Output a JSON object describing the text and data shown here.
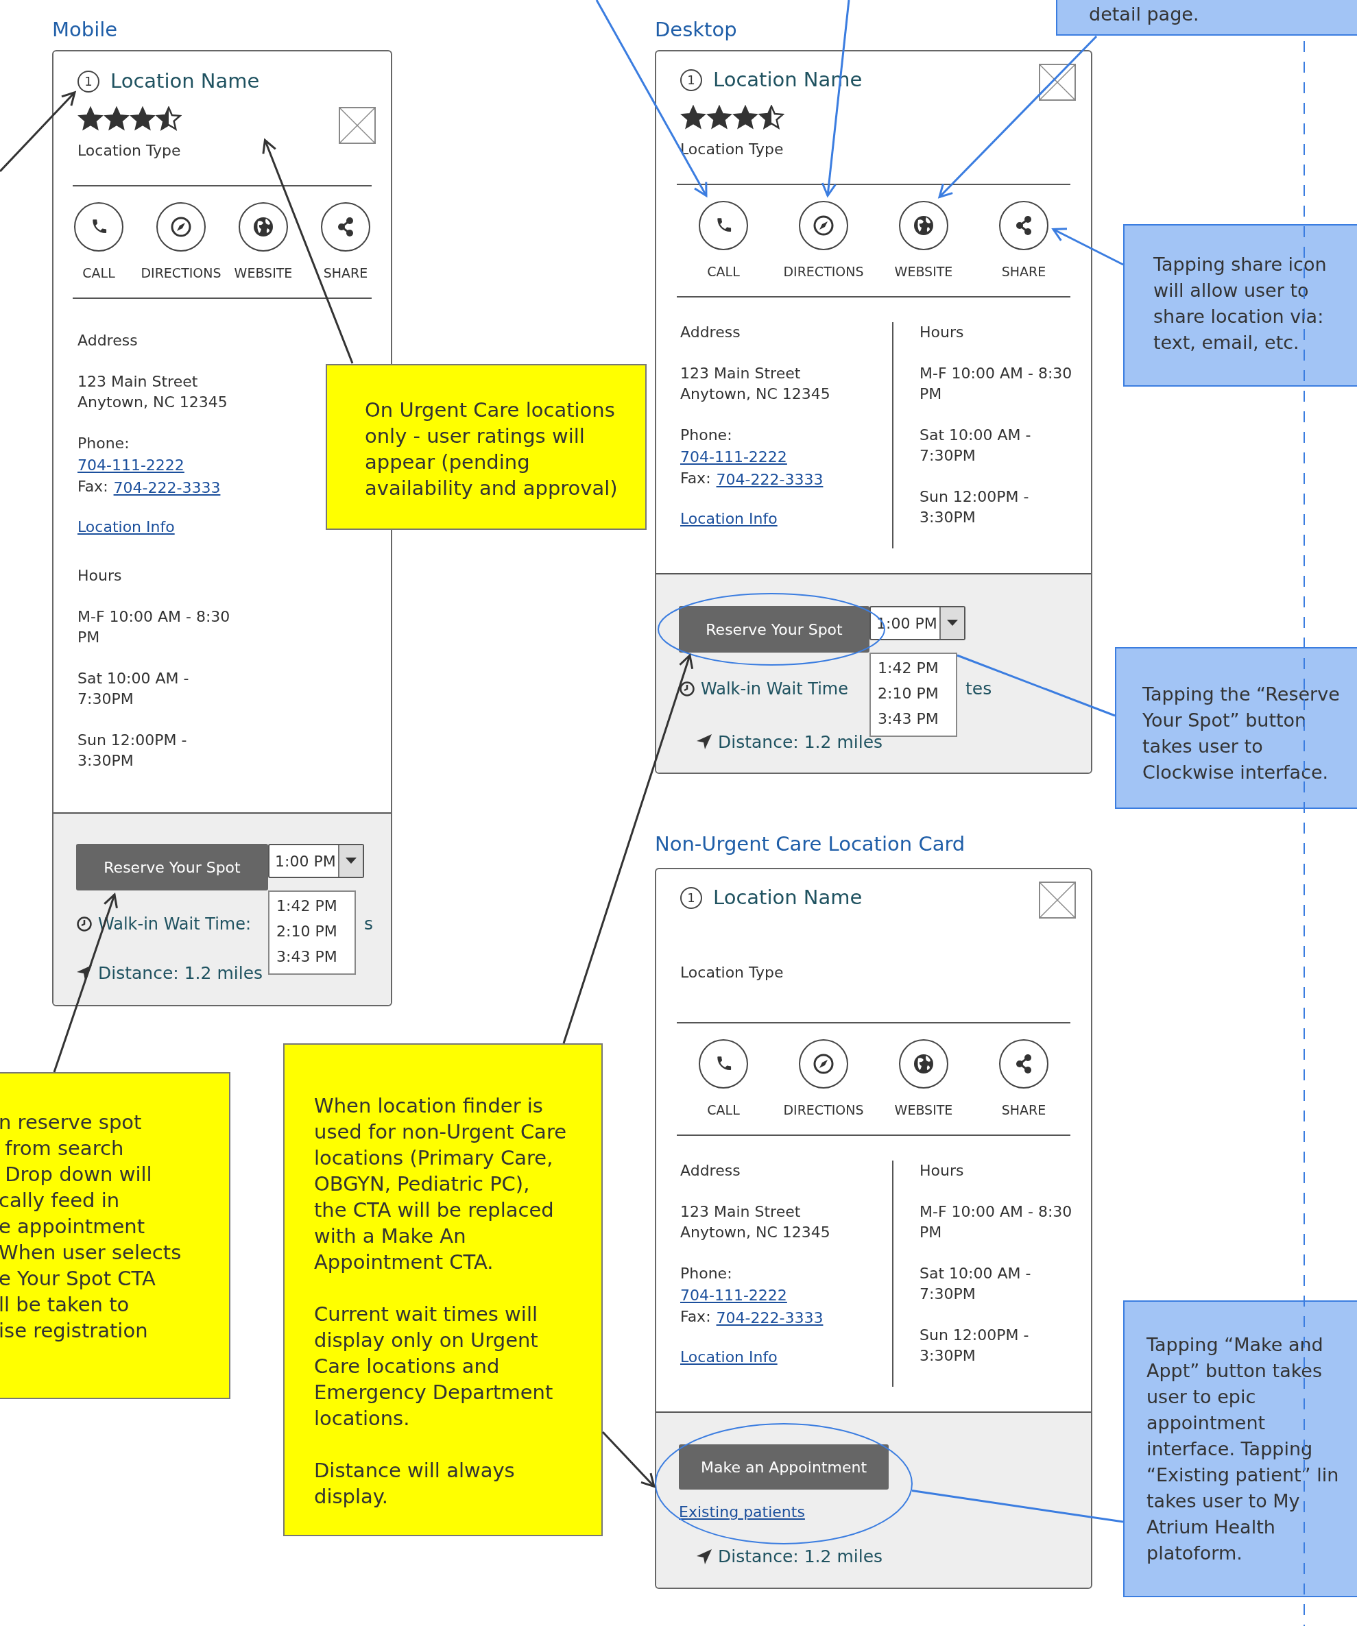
{
  "panels": [
    {
      "heading": "Mobile",
      "card": {
        "kind": "mobile",
        "number": "1",
        "name": "Location Name",
        "stars": 3.5,
        "type": "Location Type",
        "actions": [
          {
            "kind": "call",
            "label": "CALL"
          },
          {
            "kind": "directions",
            "label": "DIRECTIONS"
          },
          {
            "kind": "website",
            "label": "WEBSITE"
          },
          {
            "kind": "share",
            "label": "SHARE"
          }
        ],
        "address": {
          "heading": "Address",
          "lines": [
            "123 Main Street",
            "Anytown, NC 12345"
          ],
          "phone_label": "Phone:",
          "phone": "704-111-2222",
          "fax_label": "Fax:",
          "fax": "704-222-3333",
          "info_link": "Location Info"
        },
        "hours": {
          "heading": "Hours",
          "entries": [
            "M-F 10:00 AM - 8:30\nPM",
            "Sat 10:00 AM -\n7:30PM",
            "Sun 12:00PM -\n3:30PM"
          ]
        },
        "footer": {
          "kind": "reserve",
          "button": "Reserve Your Spot",
          "time": "1:00 PM",
          "options": [
            "1:42 PM",
            "2:10 PM",
            "3:43 PM"
          ],
          "wait": "Walk-in Wait Time:",
          "wait_tail": "s",
          "distance": "Distance: 1.2 miles"
        }
      }
    },
    {
      "heading": "Desktop",
      "card": {
        "kind": "desktop",
        "number": "1",
        "name": "Location Name",
        "stars": 3.5,
        "type": "Location Type",
        "actions": [
          {
            "kind": "call",
            "label": "CALL"
          },
          {
            "kind": "directions",
            "label": "DIRECTIONS"
          },
          {
            "kind": "website",
            "label": "WEBSITE"
          },
          {
            "kind": "share",
            "label": "SHARE"
          }
        ],
        "address": {
          "heading": "Address",
          "lines": [
            "123 Main Street",
            "Anytown, NC 12345"
          ],
          "phone_label": "Phone:",
          "phone": "704-111-2222",
          "fax_label": "Fax:",
          "fax": "704-222-3333",
          "info_link": "Location Info"
        },
        "hours": {
          "heading": "Hours",
          "entries": [
            "M-F 10:00 AM - 8:30\nPM",
            "Sat 10:00 AM -\n7:30PM",
            "Sun 12:00PM -\n3:30PM"
          ]
        },
        "footer": {
          "kind": "reserve",
          "button": "Reserve Your Spot",
          "time": "1:00 PM",
          "options": [
            "1:42 PM",
            "2:10 PM",
            "3:43 PM"
          ],
          "wait": "Walk-in Wait Time",
          "wait_tail": "tes",
          "distance": "Distance: 1.2 miles"
        }
      }
    },
    {
      "heading": "Non-Urgent Care Location Card",
      "card": {
        "kind": "desktop",
        "number": "1",
        "name": "Location Name",
        "type": "Location Type",
        "actions": [
          {
            "kind": "call",
            "label": "CALL"
          },
          {
            "kind": "directions",
            "label": "DIRECTIONS"
          },
          {
            "kind": "website",
            "label": "WEBSITE"
          },
          {
            "kind": "share",
            "label": "SHARE"
          }
        ],
        "address": {
          "heading": "Address",
          "lines": [
            "123 Main Street",
            "Anytown, NC 12345"
          ],
          "phone_label": "Phone:",
          "phone": "704-111-2222",
          "fax_label": "Fax:",
          "fax": "704-222-3333",
          "info_link": "Location Info"
        },
        "hours": {
          "heading": "Hours",
          "entries": [
            "M-F 10:00 AM - 8:30\nPM",
            "Sat 10:00 AM -\n7:30PM",
            "Sun 12:00PM -\n3:30PM"
          ]
        },
        "footer": {
          "kind": "appointment",
          "button": "Make an Appointment",
          "link": "Existing patients",
          "distance": "Distance: 1.2 miles"
        }
      }
    }
  ],
  "notes": [
    {
      "kind": "blue",
      "paragraphs": [
        "detail page."
      ]
    },
    {
      "kind": "blue",
      "paragraphs": [
        "Tapping share icon\nwill allow user to\nshare location via:\ntext, email, etc."
      ]
    },
    {
      "kind": "yellow",
      "paragraphs": [
        "On Urgent Care locations\nonly - user ratings will\nappear (pending\navailability and approval)"
      ]
    },
    {
      "kind": "blue",
      "paragraphs": [
        "Tapping the “Reserve\nYour Spot” button\ntakes user to\nClockwise interface."
      ]
    },
    {
      "kind": "yellow",
      "paragraphs": [
        "When location finder is\nused for non-Urgent Care\nlocations (Primary Care,\nOBGYN, Pediatric PC),\nthe CTA will be replaced\nwith a Make An\nAppointment CTA.",
        "Current wait times will\ndisplay only on Urgent\nCare locations and\nEmergency Department\nlocations.",
        "Distance will always\ndisplay."
      ]
    },
    {
      "kind": "yellow",
      "paragraphs": [
        "n reserve spot\n from search\n Drop down will\ncally feed in\ne appointment\nWhen user selects\ne Your Spot CTA\nll be taken to\nise registration"
      ]
    },
    {
      "kind": "blue",
      "paragraphs": [
        "Tapping “Make and\nAppt” button takes\nuser to epic\nappointment\ninterface. Tapping\n“Existing patient” lin\ntakes user to My\nAtrium Health\nplatoform."
      ]
    }
  ]
}
